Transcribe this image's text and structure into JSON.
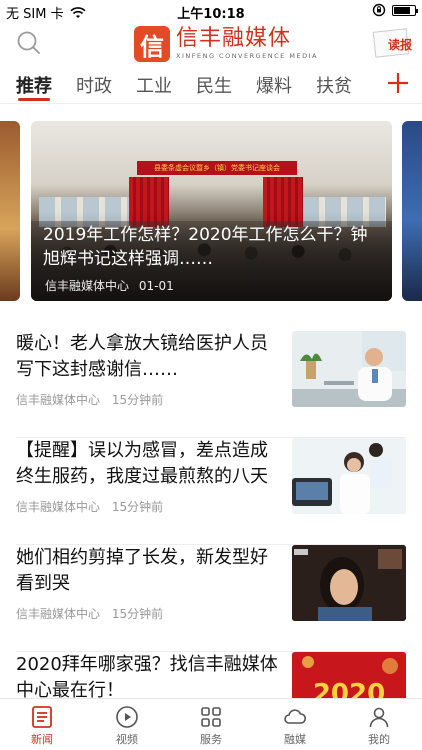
{
  "status_bar": {
    "carrier": "无 SIM 卡",
    "time": "上午10:18",
    "battery_level": 0.8
  },
  "header": {
    "logo_mark": "信",
    "logo_name": "信丰融媒体",
    "logo_subtitle": "XINFENG CONVERGENCE MEDIA",
    "paper_label": "读报"
  },
  "tabs": [
    {
      "label": "推荐",
      "active": true
    },
    {
      "label": "时政",
      "active": false
    },
    {
      "label": "工业",
      "active": false
    },
    {
      "label": "民生",
      "active": false
    },
    {
      "label": "爆料",
      "active": false
    },
    {
      "label": "扶贫",
      "active": false
    }
  ],
  "banner": {
    "stage_text": "县委条虚会议暨乡（镇）党委书记座谈会",
    "title": "2019年工作怎样？2020年工作怎么干？钟旭辉书记这样强调……",
    "source": "信丰融媒体中心",
    "date": "01-01"
  },
  "news": [
    {
      "title": "暖心！老人拿放大镜给医护人员写下这封感谢信……",
      "source": "信丰融媒体中心",
      "time": "15分钟前"
    },
    {
      "title": "【提醒】误以为感冒，差点造成终生服药，我度过最煎熬的八天",
      "source": "信丰融媒体中心",
      "time": "15分钟前"
    },
    {
      "title": "她们相约剪掉了长发，新发型好看到哭",
      "source": "信丰融媒体中心",
      "time": "15分钟前"
    },
    {
      "title": "2020拜年哪家强？找信丰融媒体中心最在行！",
      "source": "",
      "time": ""
    }
  ],
  "thumb_texts": {
    "thumb4_year": "2020"
  },
  "bottom_nav": [
    {
      "label": "新闻",
      "icon": "news-list-icon",
      "active": true
    },
    {
      "label": "视频",
      "icon": "play-circle-icon",
      "active": false
    },
    {
      "label": "服务",
      "icon": "grid-icon",
      "active": false
    },
    {
      "label": "融媒",
      "icon": "cloud-icon",
      "active": false
    },
    {
      "label": "我的",
      "icon": "person-icon",
      "active": false
    }
  ],
  "colors": {
    "accent": "#d0321e"
  }
}
